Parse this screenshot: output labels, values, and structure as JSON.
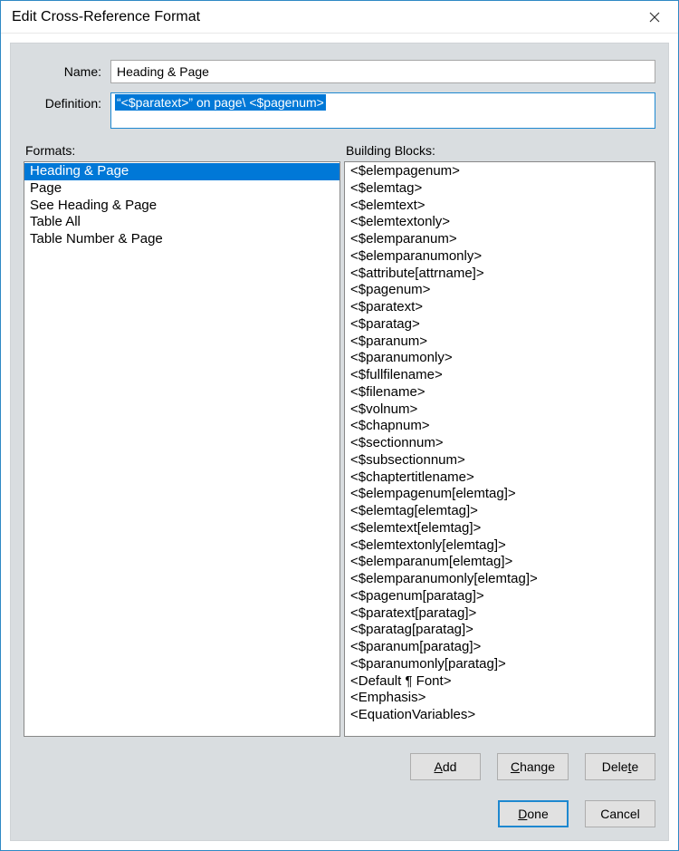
{
  "window": {
    "title": "Edit Cross-Reference Format"
  },
  "fields": {
    "name_label": "Name:",
    "name_value": "Heading & Page",
    "definition_label": "Definition:",
    "definition_value": "“<$paratext>” on page\\ <$pagenum>"
  },
  "formats": {
    "heading": "Formats:",
    "items": [
      "Heading & Page",
      "Page",
      "See Heading & Page",
      "Table All",
      "Table Number & Page"
    ],
    "selected_index": 0
  },
  "building_blocks": {
    "heading": "Building Blocks:",
    "items": [
      "<$elempagenum>",
      "<$elemtag>",
      "<$elemtext>",
      "<$elemtextonly>",
      "<$elemparanum>",
      "<$elemparanumonly>",
      "<$attribute[attrname]>",
      "<$pagenum>",
      "<$paratext>",
      "<$paratag>",
      "<$paranum>",
      "<$paranumonly>",
      "<$fullfilename>",
      "<$filename>",
      "<$volnum>",
      "<$chapnum>",
      "<$sectionnum>",
      "<$subsectionnum>",
      "<$chaptertitlename>",
      "<$elempagenum[elemtag]>",
      "<$elemtag[elemtag]>",
      "<$elemtext[elemtag]>",
      "<$elemtextonly[elemtag]>",
      "<$elemparanum[elemtag]>",
      "<$elemparanumonly[elemtag]>",
      "<$pagenum[paratag]>",
      "<$paratext[paratag]>",
      "<$paratag[paratag]>",
      "<$paranum[paratag]>",
      "<$paranumonly[paratag]>",
      "<Default ¶ Font>",
      "<Emphasis>",
      "<EquationVariables>"
    ]
  },
  "buttons": {
    "add": "Add",
    "change": "Change",
    "delete": "Delete",
    "done": "Done",
    "cancel": "Cancel"
  }
}
